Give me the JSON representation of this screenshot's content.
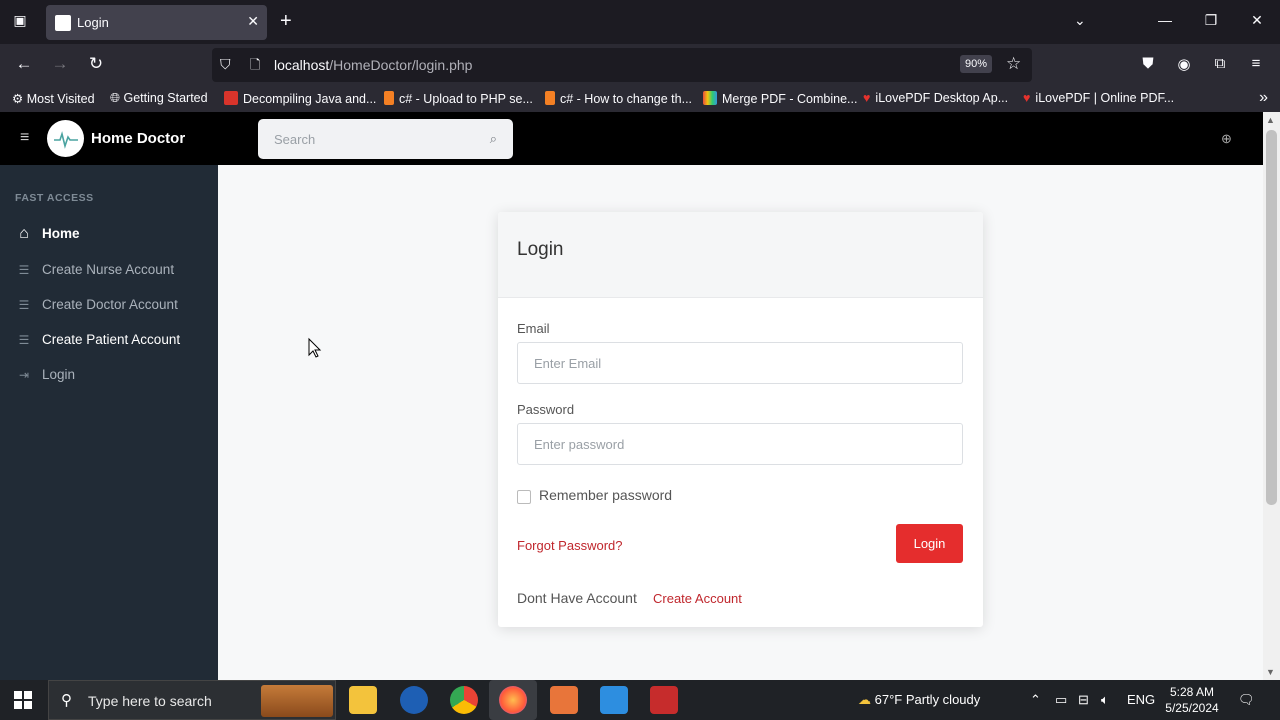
{
  "browser": {
    "tab": {
      "title": "Login"
    },
    "url": {
      "host": "localhost",
      "path": "/HomeDoctor/login.php"
    },
    "zoom": "90%",
    "bookmarks": [
      {
        "label": "Most Visited",
        "icon": "gear-icon"
      },
      {
        "label": "Getting Started",
        "icon": "globe-icon"
      },
      {
        "label": "Decompiling Java and...",
        "icon": "red-favicon",
        "color": "#d9342b"
      },
      {
        "label": "c# - Upload to PHP se...",
        "icon": "stackoverflow-icon",
        "color": "#f48024"
      },
      {
        "label": "c# - How to change th...",
        "icon": "stackoverflow-icon",
        "color": "#f48024"
      },
      {
        "label": "Merge PDF - Combine...",
        "icon": "multicolor-favicon",
        "color": "#6ab04c"
      },
      {
        "label": "iLovePDF Desktop Ap...",
        "icon": "heart-icon",
        "color": "#e5322d"
      },
      {
        "label": "iLovePDF | Online PDF...",
        "icon": "heart-icon",
        "color": "#e5322d"
      }
    ]
  },
  "header": {
    "brand": "Home Doctor",
    "search_placeholder": "Search"
  },
  "sidebar": {
    "heading": "FAST ACCESS",
    "items": [
      {
        "label": "Home",
        "icon": "home-icon"
      },
      {
        "label": "Create Nurse Account",
        "icon": "list-icon"
      },
      {
        "label": "Create Doctor Account",
        "icon": "list-icon"
      },
      {
        "label": "Create Patient Account",
        "icon": "list-icon"
      },
      {
        "label": "Login",
        "icon": "sign-in-icon"
      }
    ]
  },
  "login": {
    "title": "Login",
    "email_label": "Email",
    "email_placeholder": "Enter Email",
    "password_label": "Password",
    "password_placeholder": "Enter password",
    "remember_label": "Remember password",
    "forgot_label": "Forgot Password?",
    "submit_label": "Login",
    "no_account_text": "Dont Have Account",
    "create_account_label": "Create Account"
  },
  "taskbar": {
    "search_placeholder": "Type here to search",
    "weather": "67°F  Partly cloudy",
    "language": "ENG",
    "time": "5:28 AM",
    "date": "5/25/2024"
  },
  "colors": {
    "accent": "#e52d2d",
    "link": "#c0272d",
    "sidebar": "#212b36",
    "header": "#000000"
  }
}
